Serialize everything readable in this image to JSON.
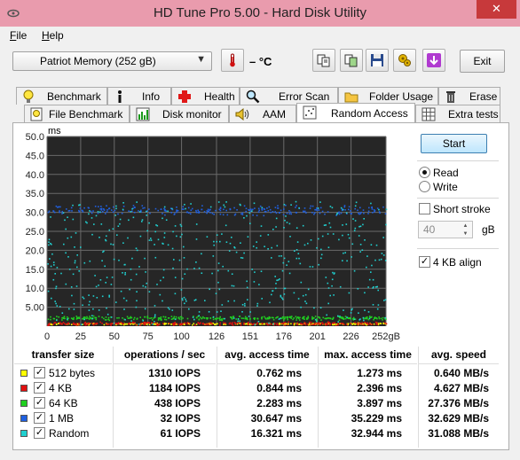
{
  "window": {
    "title": "HD Tune Pro 5.00 - Hard Disk Utility",
    "close": "✕"
  },
  "menu": {
    "file": "File",
    "file_hot": "F",
    "file_rest": "ile",
    "help": "Help",
    "help_hot": "H",
    "help_rest": "elp"
  },
  "toolbar": {
    "drive": "Patriot Memory   (252 gB)",
    "temperature": "– °C",
    "exit": "Exit"
  },
  "tabs_top": [
    "Benchmark",
    "Info",
    "Health",
    "Error Scan",
    "Folder Usage",
    "Erase"
  ],
  "tabs_bottom": [
    "File Benchmark",
    "Disk monitor",
    "AAM",
    "Random Access",
    "Extra tests"
  ],
  "active_tab": "Random Access",
  "controls": {
    "start": "Start",
    "read": "Read",
    "write": "Write",
    "mode": "Read",
    "short_stroke": "Short stroke",
    "short_stroke_checked": false,
    "short_stroke_value": "40",
    "short_stroke_unit": "gB",
    "align": "4 KB align",
    "align_checked": true
  },
  "results": {
    "headers": [
      "transfer size",
      "operations / sec",
      "avg. access time",
      "max. access time",
      "avg. speed"
    ],
    "rows": [
      {
        "size": "512 bytes",
        "ops": "1310 IOPS",
        "avg": "0.762 ms",
        "max": "1.273 ms",
        "speed": "0.640 MB/s",
        "color": "#ffff00"
      },
      {
        "size": "4 KB",
        "ops": "1184 IOPS",
        "avg": "0.844 ms",
        "max": "2.396 ms",
        "speed": "4.627 MB/s",
        "color": "#e01010"
      },
      {
        "size": "64 KB",
        "ops": "438 IOPS",
        "avg": "2.283 ms",
        "max": "3.897 ms",
        "speed": "27.376 MB/s",
        "color": "#20d020"
      },
      {
        "size": "1 MB",
        "ops": "32 IOPS",
        "avg": "30.647 ms",
        "max": "35.229 ms",
        "speed": "32.629 MB/s",
        "color": "#2060e0"
      },
      {
        "size": "Random",
        "ops": "61 IOPS",
        "avg": "16.321 ms",
        "max": "32.944 ms",
        "speed": "31.088 MB/s",
        "color": "#20d0d0"
      }
    ]
  },
  "chart_data": {
    "type": "scatter",
    "ylabel": "ms",
    "ylim": [
      0,
      50
    ],
    "xlim": [
      0,
      252
    ],
    "y_ticks": [
      "50.0",
      "45.0",
      "40.0",
      "35.0",
      "30.0",
      "25.0",
      "20.0",
      "15.0",
      "10.0",
      "5.00"
    ],
    "x_ticks": [
      "0",
      "25",
      "50",
      "75",
      "100",
      "126",
      "151",
      "176",
      "201",
      "226",
      "252gB"
    ],
    "grid": true,
    "series": [
      {
        "name": "512 bytes",
        "color": "#ffff00",
        "y_center": 0.76,
        "y_spread": 0.3
      },
      {
        "name": "4 KB",
        "color": "#e01010",
        "y_center": 0.84,
        "y_spread": 0.5
      },
      {
        "name": "64 KB",
        "color": "#20d020",
        "y_center": 2.28,
        "y_spread": 0.6
      },
      {
        "name": "1 MB",
        "color": "#2060e0",
        "y_center": 30.65,
        "y_spread": 1.5
      },
      {
        "name": "Random",
        "color": "#20d0d0",
        "y_center": 16.32,
        "y_spread": 16.5
      }
    ]
  }
}
